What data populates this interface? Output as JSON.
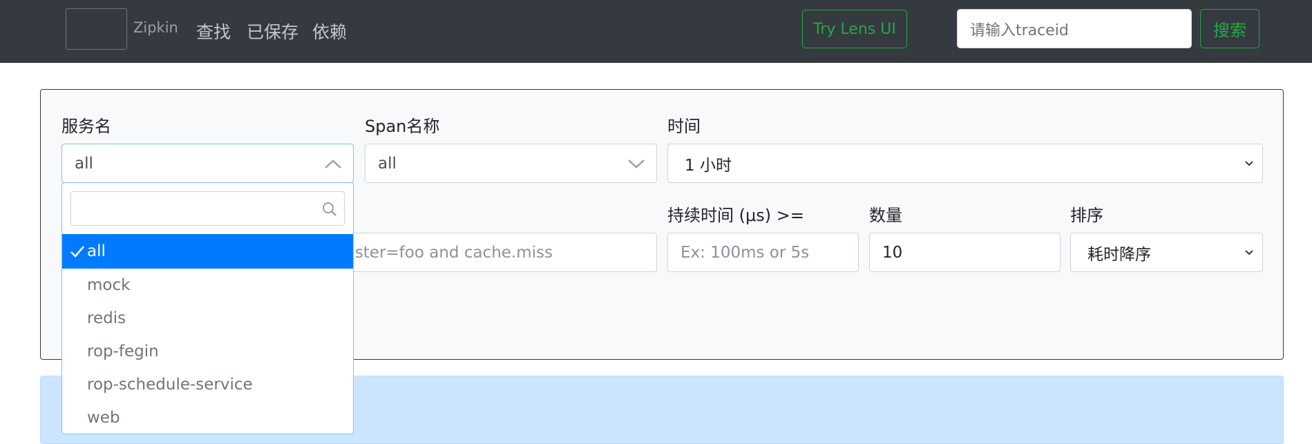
{
  "navbar": {
    "brand": "Zipkin",
    "links": [
      "查找",
      "已保存",
      "依赖"
    ],
    "try_lens": "Try Lens UI",
    "trace_placeholder": "请输入traceid",
    "search_button": "搜索"
  },
  "form": {
    "service_label": "服务名",
    "service_value": "all",
    "span_label": "Span名称",
    "span_value": "all",
    "time_label": "时间",
    "time_value": "1 小时",
    "tags_placeholder_visible": "cluster=foo and cache.miss",
    "duration_label": "持续时间 (μs) >=",
    "duration_placeholder": "Ex: 100ms or 5s",
    "limit_label": "数量",
    "limit_value": "10",
    "sort_label": "排序",
    "sort_value": "耗时降序"
  },
  "dropdown": {
    "items": [
      "all",
      "mock",
      "redis",
      "rop-fegin",
      "rop-schedule-service",
      "web"
    ],
    "selected": "all"
  },
  "colors": {
    "navbar_bg": "#343a40",
    "success": "#28a745",
    "primary": "#007bff",
    "alert_bg": "#cce5ff"
  }
}
